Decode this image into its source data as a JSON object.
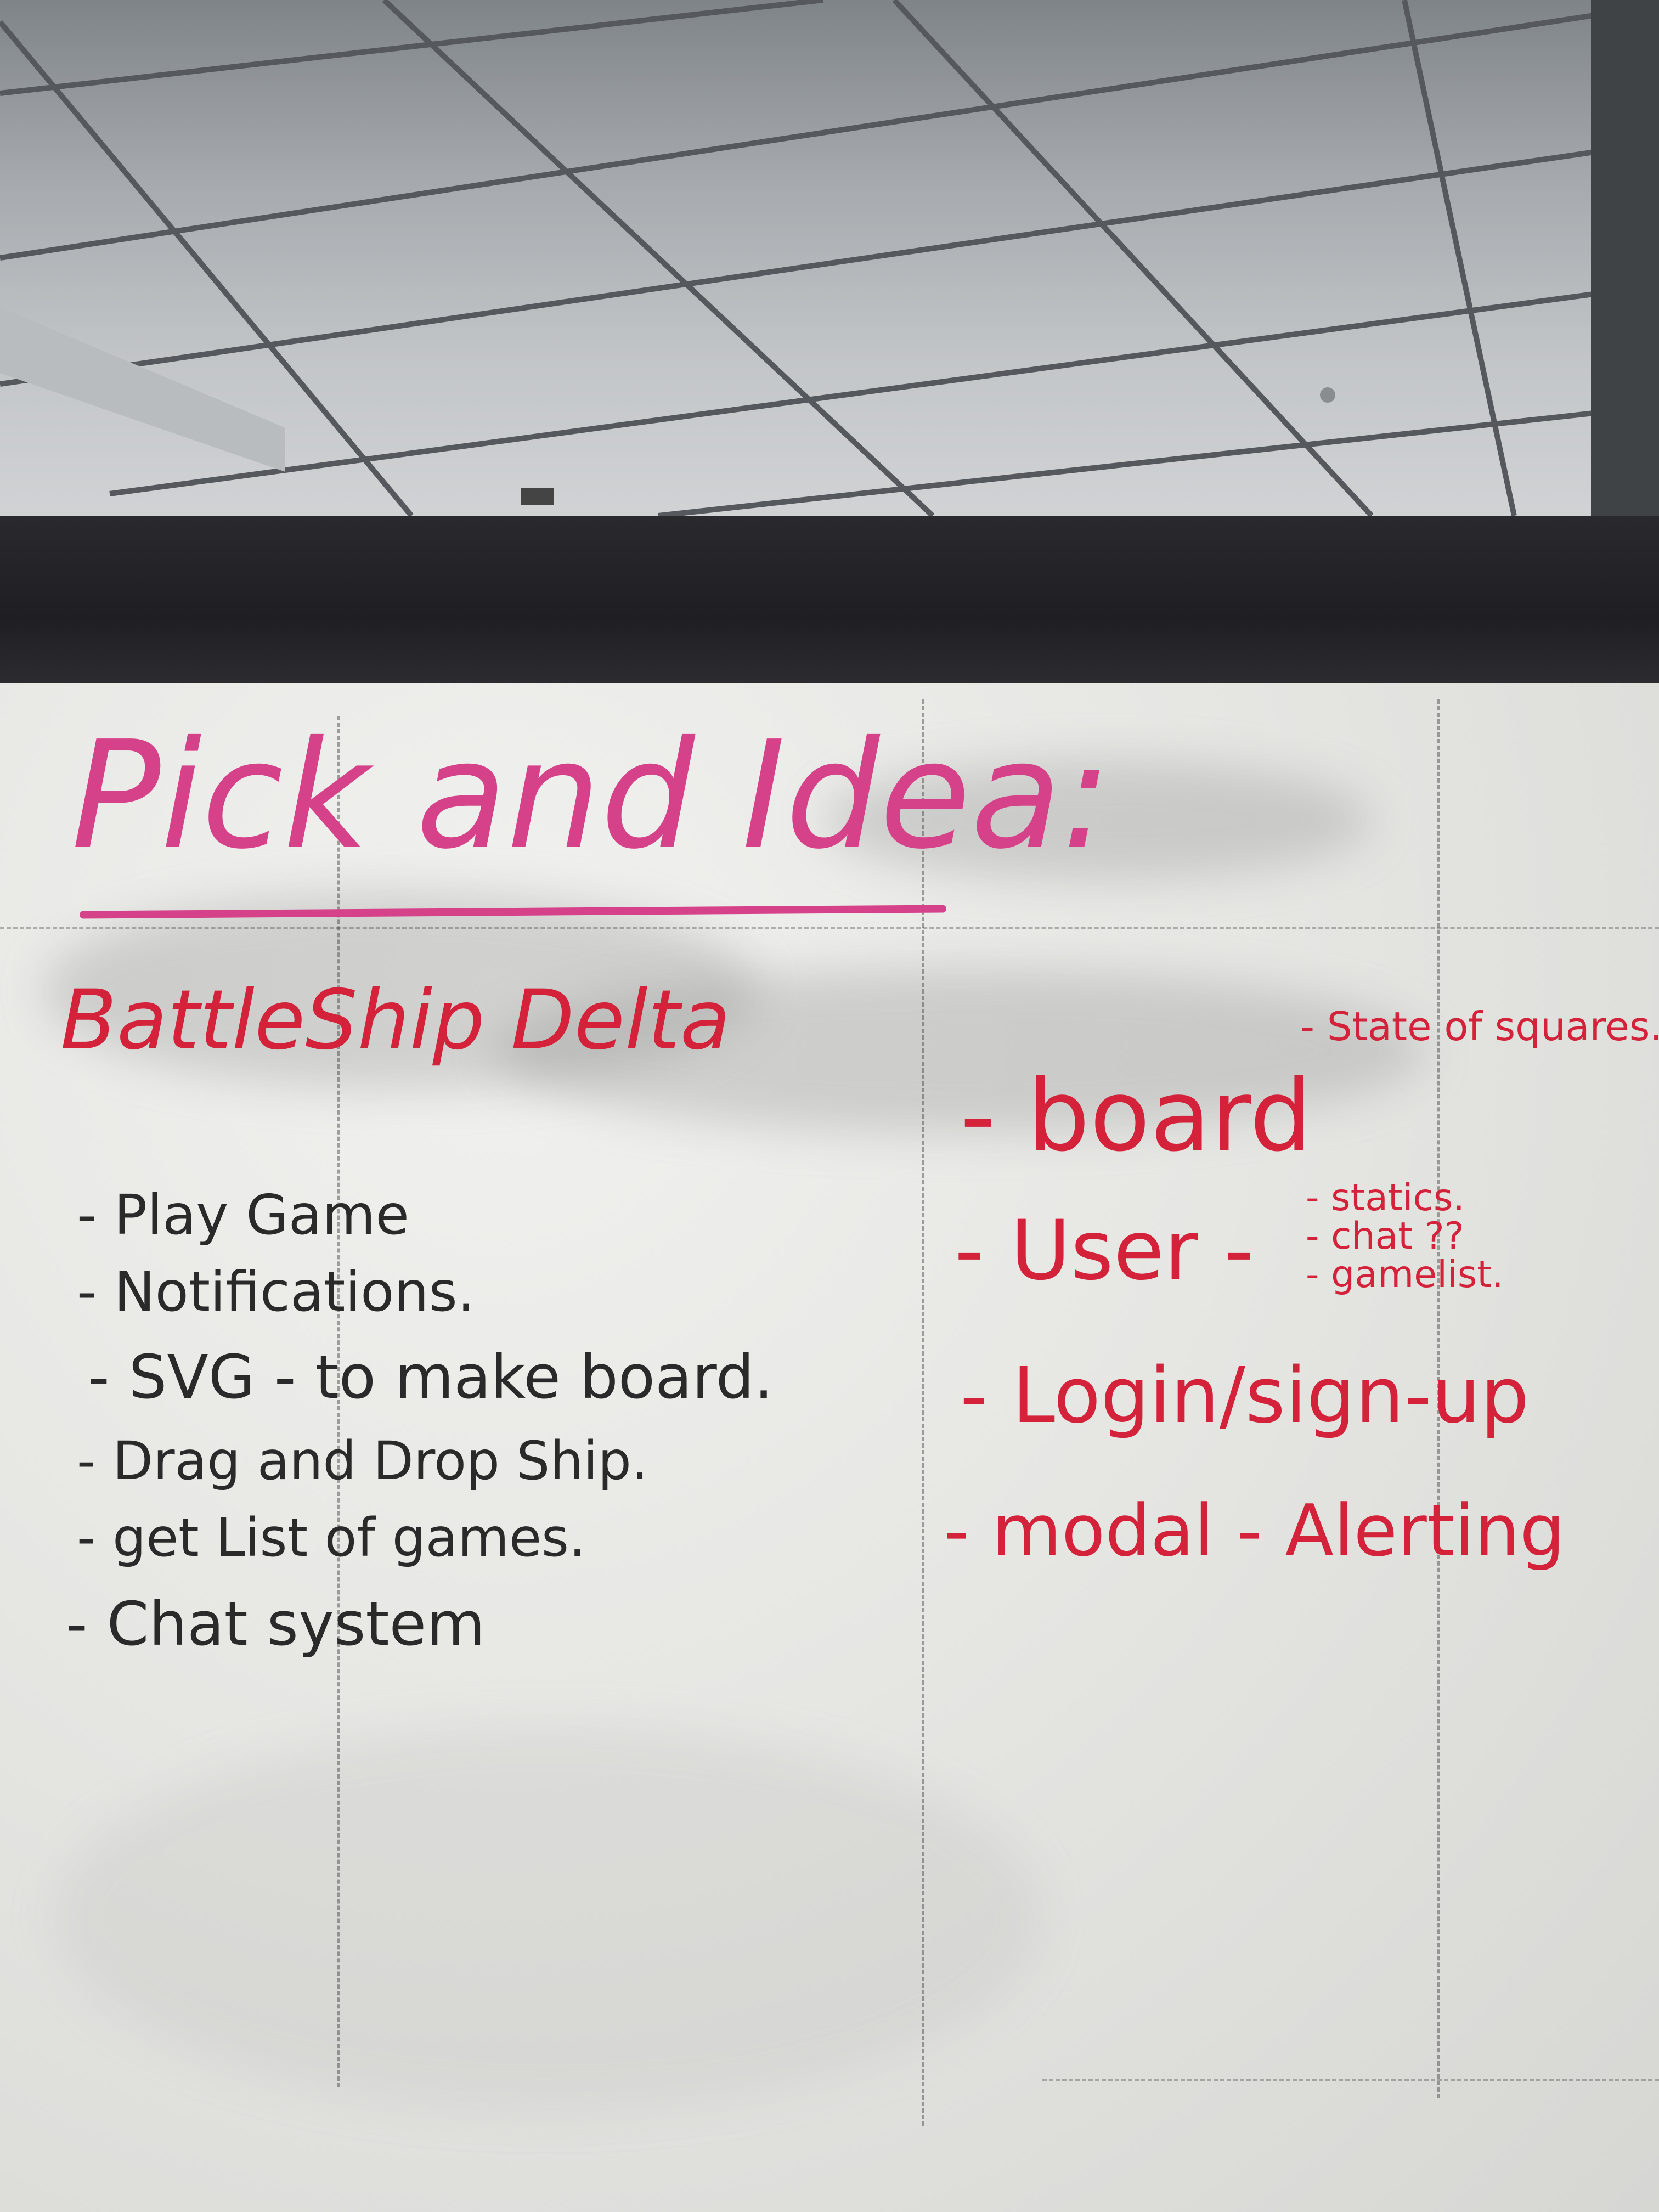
{
  "whiteboard": {
    "title": "Pick and Idea:",
    "project_name": "BattleShip Delta",
    "features": [
      "- Play Game",
      "- Notifications.",
      "- SVG - to make board.",
      "- Drag and Drop Ship.",
      "- get List of games.",
      "- Chat system"
    ],
    "components": {
      "board": "- board",
      "board_note": "- State of squares.",
      "user": "- User -",
      "user_notes": [
        "- statics.",
        "- chat ??",
        "- gamelist."
      ],
      "login": "- Login/sign-up",
      "modal": "- modal - Alerting"
    }
  },
  "colors": {
    "pink_marker": "#d6428a",
    "red_marker": "#d3223a",
    "black_marker": "#2a2a2a",
    "frame": "#1f1f23"
  }
}
